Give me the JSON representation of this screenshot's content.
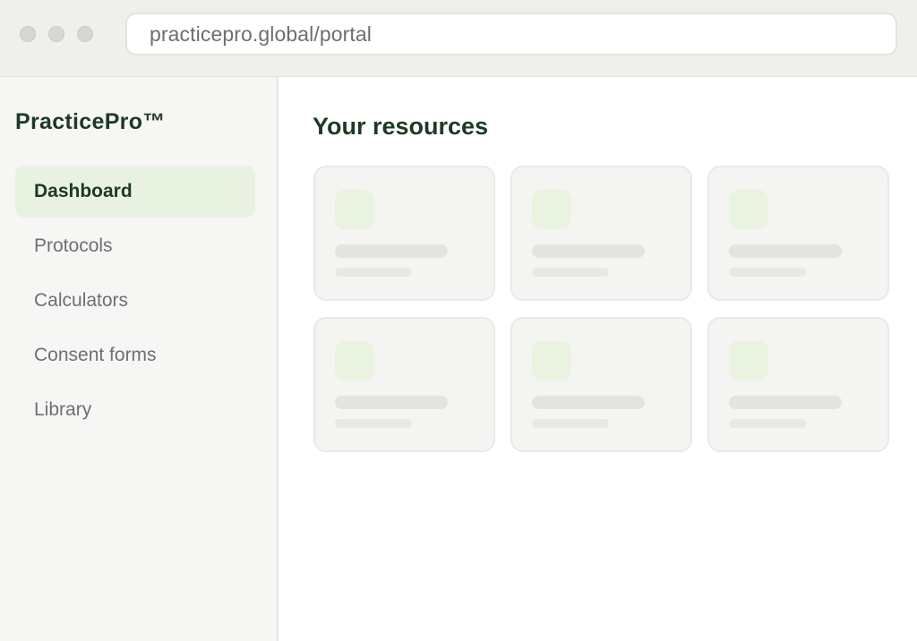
{
  "browser": {
    "url": "practicepro.global/portal",
    "window_controls": [
      "close",
      "minimize",
      "maximize"
    ]
  },
  "sidebar": {
    "brand": "PracticePro™",
    "items": [
      {
        "label": "Dashboard",
        "active": true
      },
      {
        "label": "Protocols",
        "active": false
      },
      {
        "label": "Calculators",
        "active": false
      },
      {
        "label": "Consent forms",
        "active": false
      },
      {
        "label": "Library",
        "active": false
      }
    ]
  },
  "main": {
    "title": "Your resources",
    "cards_loading": true
  },
  "colors": {
    "brand_text": "#1d3a26",
    "active_nav_bg": "#e9f2e0",
    "placeholder_thumb": "#e9f3e0"
  }
}
